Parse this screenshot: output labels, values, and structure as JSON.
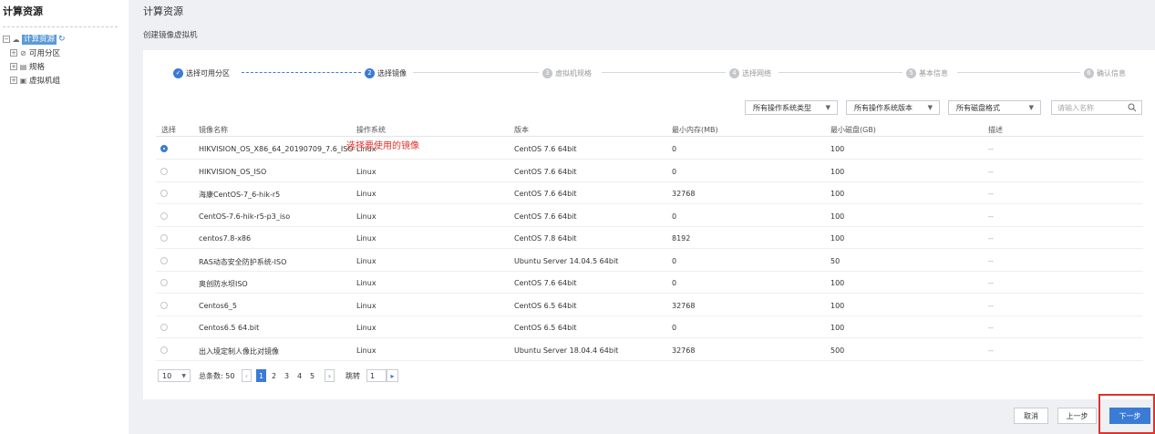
{
  "sidebar": {
    "title": "计算资源",
    "tree": [
      {
        "label": "计算资源",
        "selected": true
      },
      {
        "label": "可用分区"
      },
      {
        "label": "规格"
      },
      {
        "label": "虚拟机组"
      }
    ]
  },
  "header": {
    "title": "计算资源",
    "subtitle": "创建镜像虚拟机"
  },
  "steps": [
    {
      "num": "✓",
      "label": "选择可用分区"
    },
    {
      "num": "2",
      "label": "选择镜像"
    },
    {
      "num": "3",
      "label": "虚拟机规格"
    },
    {
      "num": "4",
      "label": "选择网络"
    },
    {
      "num": "5",
      "label": "基本信息"
    },
    {
      "num": "6",
      "label": "确认信息"
    }
  ],
  "filters": {
    "os_type": "所有操作系统类型",
    "os_version": "所有操作系统版本",
    "disk_format": "所有磁盘格式",
    "search_placeholder": "请输入名称"
  },
  "table": {
    "headers": [
      "选择",
      "镜像名称",
      "操作系统",
      "版本",
      "最小内存(MB)",
      "最小磁盘(GB)",
      "描述"
    ],
    "rows": [
      {
        "name": "HIKVISION_OS_X86_64_20190709_7.6_ISO",
        "os": "Linux",
        "version": "CentOS 7.6 64bit",
        "mem": "0",
        "disk": "100",
        "desc": "--",
        "selected": true
      },
      {
        "name": "HIKVISION_OS_ISO",
        "os": "Linux",
        "version": "CentOS 7.6 64bit",
        "mem": "0",
        "disk": "100",
        "desc": "--"
      },
      {
        "name": "海康CentOS-7_6-hik-r5",
        "os": "Linux",
        "version": "CentOS 7.6 64bit",
        "mem": "32768",
        "disk": "100",
        "desc": "--"
      },
      {
        "name": "CentOS-7.6-hik-r5-p3_iso",
        "os": "Linux",
        "version": "CentOS 7.6 64bit",
        "mem": "0",
        "disk": "100",
        "desc": "--"
      },
      {
        "name": "centos7.8-x86",
        "os": "Linux",
        "version": "CentOS 7.8 64bit",
        "mem": "8192",
        "disk": "100",
        "desc": "--"
      },
      {
        "name": "RAS动态安全防护系统-ISO",
        "os": "Linux",
        "version": "Ubuntu Server 14.04.5 64bit",
        "mem": "0",
        "disk": "50",
        "desc": "--"
      },
      {
        "name": "奥创防水坝ISO",
        "os": "Linux",
        "version": "CentOS 7.6 64bit",
        "mem": "0",
        "disk": "100",
        "desc": "--"
      },
      {
        "name": "Centos6_5",
        "os": "Linux",
        "version": "CentOS 6.5 64bit",
        "mem": "32768",
        "disk": "100",
        "desc": "--"
      },
      {
        "name": "Centos6.5 64.bit",
        "os": "Linux",
        "version": "CentOS 6.5 64bit",
        "mem": "0",
        "disk": "100",
        "desc": "--"
      },
      {
        "name": "出入境定制人像比对镜像",
        "os": "Linux",
        "version": "Ubuntu Server 18.04.4 64bit",
        "mem": "32768",
        "disk": "500",
        "desc": "--"
      }
    ]
  },
  "annotation": "选择要使用的镜像",
  "pagination": {
    "page_size": "10",
    "total_label": "总条数: 50",
    "pages": [
      "1",
      "2",
      "3",
      "4",
      "5"
    ],
    "current_page": "1",
    "jump_label": "跳转",
    "jump_value": "1"
  },
  "buttons": {
    "cancel": "取消",
    "prev": "上一步",
    "next": "下一步"
  },
  "colors": {
    "accent": "#3a7bd5",
    "annotation": "#e0312e"
  }
}
